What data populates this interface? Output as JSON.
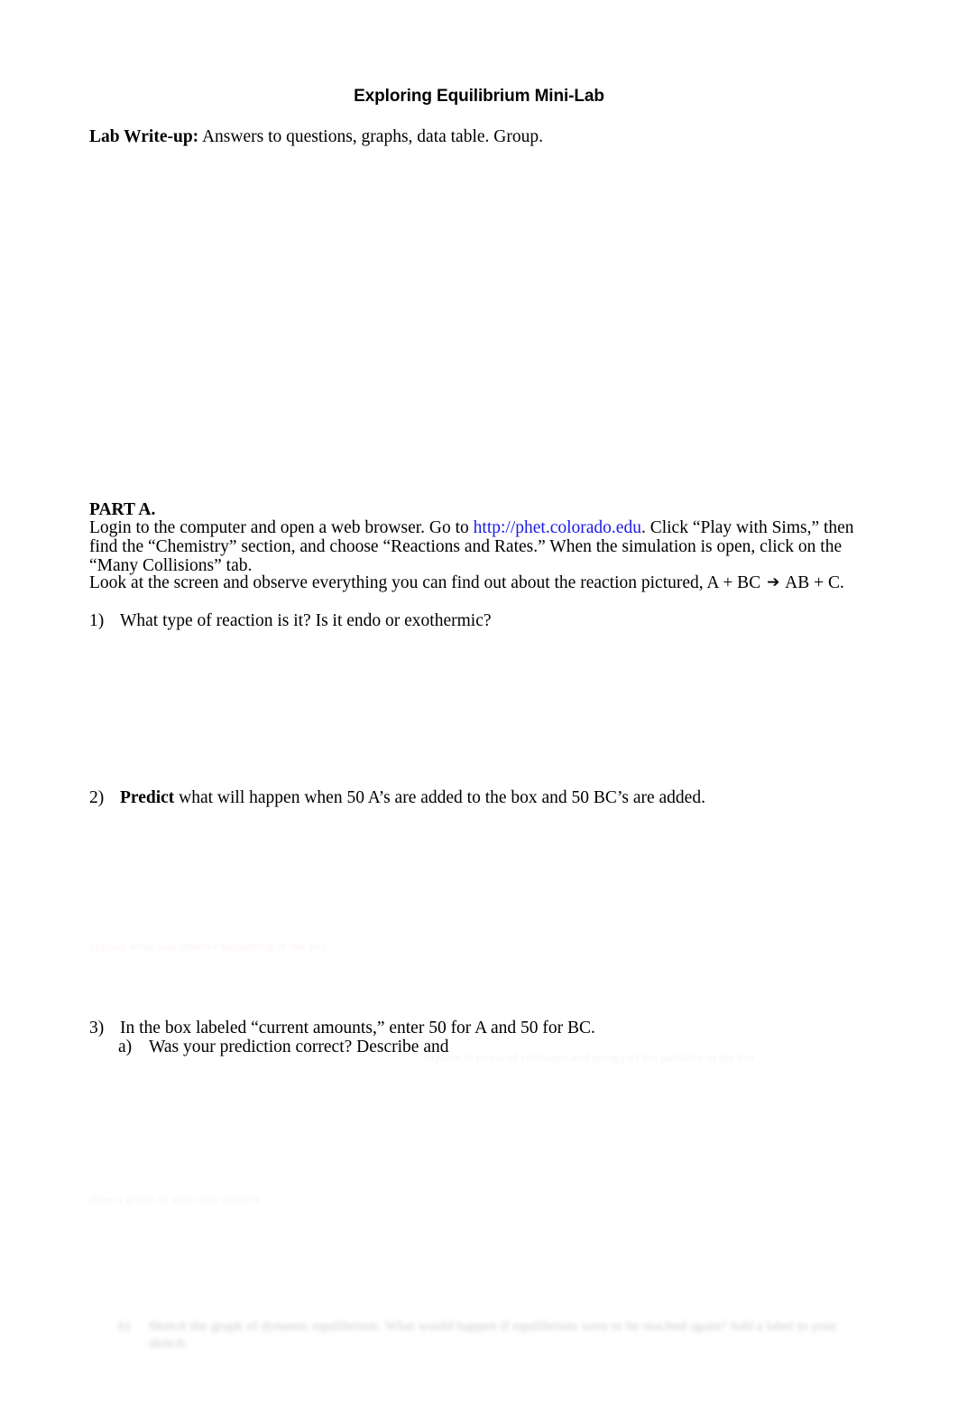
{
  "document": {
    "title": "Exploring Equilibrium Mini-Lab",
    "lab_writeup": {
      "label": "Lab Write-up:",
      "text": " Answers to questions, graphs, data table.  Group."
    },
    "part_a": {
      "heading": "PART A.",
      "instructions_pre_link": "Login to the computer and open a web browser.  Go to ",
      "link_text": "http://phet.colorado.edu",
      "instructions_post_link": ".  Click “Play with Sims,” then find the “Chemistry” section, and choose “Reactions and Rates.”  When the simulation is open, click on the “Many Collisions” tab.",
      "observe_pre": "Look at the screen and observe everything you can find out about the reaction pictured, A + BC ",
      "reaction_arrow": "➔",
      "observe_post": " AB + C."
    },
    "questions": [
      {
        "marker": "1)",
        "text": "What type of reaction is it?  Is it endo or exothermic?"
      },
      {
        "marker": "2)",
        "bold_lead": "Predict",
        "text": " what will happen when 50 A’s are added to the box and 50 BC’s are added."
      },
      {
        "marker": "3)",
        "text": "In the box labeled “current amounts,” enter 50 for A and 50 for BC.",
        "sub_items": [
          {
            "marker": "a)",
            "text": "Was your prediction correct?  Describe and"
          }
        ]
      }
    ],
    "faded_artifacts": {
      "ghost_line_1": "explain what you observe happening in the box",
      "ghost_line_2": "draw a graph of what you observe",
      "ghost_line_3": "explain in terms of collisions and energy of the particles in the box",
      "ghost_block": {
        "marker": "b)",
        "text": "Sketch the graph of dynamic equilibrium. What would happen if equilibrium were to be reached again? Add a label to your sketch."
      }
    }
  }
}
